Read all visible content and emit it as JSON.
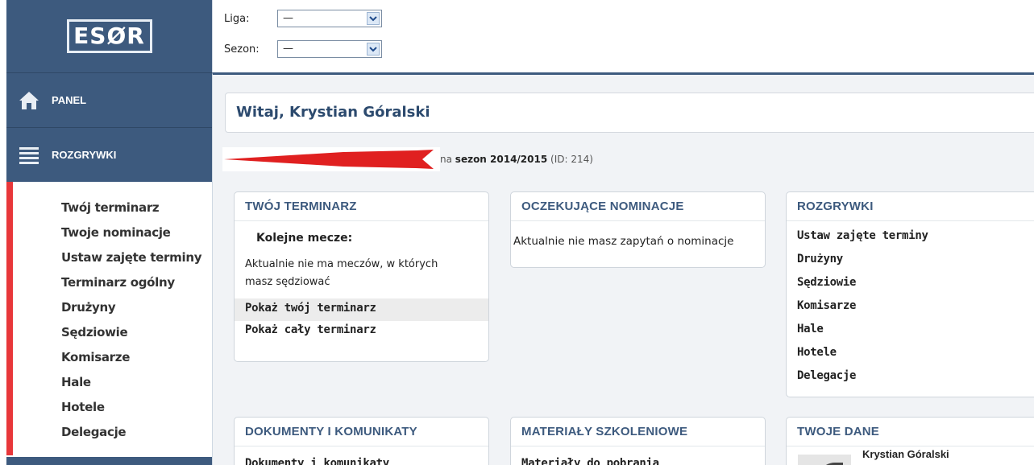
{
  "app": {
    "logo_text": "ESØR"
  },
  "sidebar": {
    "nav": [
      {
        "label": "PANEL",
        "icon": "home-icon"
      },
      {
        "label": "ROZGRYWKI",
        "icon": "menu-icon"
      }
    ],
    "items": [
      {
        "label": "Twój terminarz"
      },
      {
        "label": "Twoje nominacje"
      },
      {
        "label": "Ustaw zajęte terminy"
      },
      {
        "label": "Terminarz ogólny"
      },
      {
        "label": "Drużyny"
      },
      {
        "label": "Sędziowie"
      },
      {
        "label": "Komisarze"
      },
      {
        "label": "Hale"
      },
      {
        "label": "Hotele"
      },
      {
        "label": "Delegacje"
      }
    ]
  },
  "filters": {
    "liga": {
      "label": "Liga:",
      "value": "—"
    },
    "sezon": {
      "label": "Sezon:",
      "value": "—"
    }
  },
  "main": {
    "welcome": "Witaj, Krystian Góralski",
    "season": {
      "prefix": "na",
      "season": "sezon 2014/2015",
      "id": "(ID: 214)"
    },
    "cards": {
      "terminarz": {
        "title": "TWÓJ TERMINARZ",
        "subtitle": "Kolejne mecze:",
        "text": "Aktualnie nie ma meczów, w których masz sędziować",
        "links": [
          "Pokaż twój terminarz",
          "Pokaż cały terminarz"
        ]
      },
      "nominacje": {
        "title": "OCZEKUJĄCE NOMINACJE",
        "text": "Aktualnie nie masz zapytań o nominacje"
      },
      "rozgrywki": {
        "title": "ROZGRYWKI",
        "links": [
          "Ustaw zajęte terminy",
          "Drużyny",
          "Sędziowie",
          "Komisarze",
          "Hale",
          "Hotele",
          "Delegacje"
        ]
      },
      "dokumenty": {
        "title": "DOKUMENTY I KOMUNIKATY",
        "links": [
          "Dokumenty i komunikaty"
        ]
      },
      "materialy": {
        "title": "MATERIAŁY SZKOLENIOWE",
        "links": [
          "Materiały do pobrania"
        ]
      },
      "dane": {
        "title": "TWOJE DANE",
        "name": "Krystian Góralski"
      }
    }
  },
  "colors": {
    "sidebar_bg": "#3d5a7e",
    "accent_red": "#e8373a",
    "title_blue": "#3d5a7e"
  }
}
